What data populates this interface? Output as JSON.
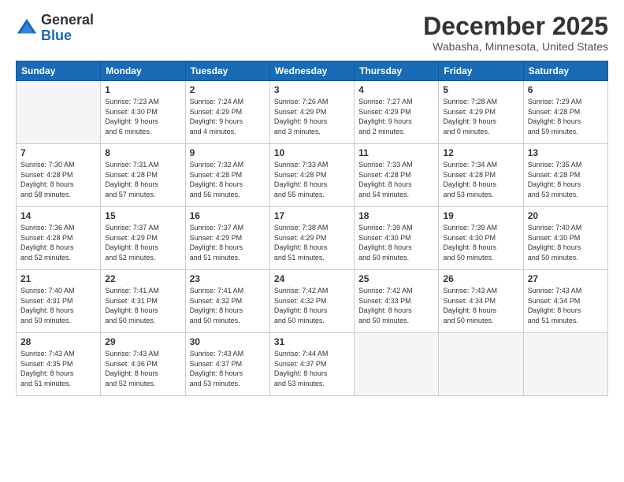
{
  "header": {
    "logo_general": "General",
    "logo_blue": "Blue",
    "month_title": "December 2025",
    "location": "Wabasha, Minnesota, United States"
  },
  "weekdays": [
    "Sunday",
    "Monday",
    "Tuesday",
    "Wednesday",
    "Thursday",
    "Friday",
    "Saturday"
  ],
  "weeks": [
    [
      {
        "day": "",
        "info": ""
      },
      {
        "day": "1",
        "info": "Sunrise: 7:23 AM\nSunset: 4:30 PM\nDaylight: 9 hours\nand 6 minutes."
      },
      {
        "day": "2",
        "info": "Sunrise: 7:24 AM\nSunset: 4:29 PM\nDaylight: 9 hours\nand 4 minutes."
      },
      {
        "day": "3",
        "info": "Sunrise: 7:26 AM\nSunset: 4:29 PM\nDaylight: 9 hours\nand 3 minutes."
      },
      {
        "day": "4",
        "info": "Sunrise: 7:27 AM\nSunset: 4:29 PM\nDaylight: 9 hours\nand 2 minutes."
      },
      {
        "day": "5",
        "info": "Sunrise: 7:28 AM\nSunset: 4:29 PM\nDaylight: 9 hours\nand 0 minutes."
      },
      {
        "day": "6",
        "info": "Sunrise: 7:29 AM\nSunset: 4:28 PM\nDaylight: 8 hours\nand 59 minutes."
      }
    ],
    [
      {
        "day": "7",
        "info": "Sunrise: 7:30 AM\nSunset: 4:28 PM\nDaylight: 8 hours\nand 58 minutes."
      },
      {
        "day": "8",
        "info": "Sunrise: 7:31 AM\nSunset: 4:28 PM\nDaylight: 8 hours\nand 57 minutes."
      },
      {
        "day": "9",
        "info": "Sunrise: 7:32 AM\nSunset: 4:28 PM\nDaylight: 8 hours\nand 56 minutes."
      },
      {
        "day": "10",
        "info": "Sunrise: 7:33 AM\nSunset: 4:28 PM\nDaylight: 8 hours\nand 55 minutes."
      },
      {
        "day": "11",
        "info": "Sunrise: 7:33 AM\nSunset: 4:28 PM\nDaylight: 8 hours\nand 54 minutes."
      },
      {
        "day": "12",
        "info": "Sunrise: 7:34 AM\nSunset: 4:28 PM\nDaylight: 8 hours\nand 53 minutes."
      },
      {
        "day": "13",
        "info": "Sunrise: 7:35 AM\nSunset: 4:28 PM\nDaylight: 8 hours\nand 53 minutes."
      }
    ],
    [
      {
        "day": "14",
        "info": "Sunrise: 7:36 AM\nSunset: 4:28 PM\nDaylight: 8 hours\nand 52 minutes."
      },
      {
        "day": "15",
        "info": "Sunrise: 7:37 AM\nSunset: 4:29 PM\nDaylight: 8 hours\nand 52 minutes."
      },
      {
        "day": "16",
        "info": "Sunrise: 7:37 AM\nSunset: 4:29 PM\nDaylight: 8 hours\nand 51 minutes."
      },
      {
        "day": "17",
        "info": "Sunrise: 7:38 AM\nSunset: 4:29 PM\nDaylight: 8 hours\nand 51 minutes."
      },
      {
        "day": "18",
        "info": "Sunrise: 7:39 AM\nSunset: 4:30 PM\nDaylight: 8 hours\nand 50 minutes."
      },
      {
        "day": "19",
        "info": "Sunrise: 7:39 AM\nSunset: 4:30 PM\nDaylight: 8 hours\nand 50 minutes."
      },
      {
        "day": "20",
        "info": "Sunrise: 7:40 AM\nSunset: 4:30 PM\nDaylight: 8 hours\nand 50 minutes."
      }
    ],
    [
      {
        "day": "21",
        "info": "Sunrise: 7:40 AM\nSunset: 4:31 PM\nDaylight: 8 hours\nand 50 minutes."
      },
      {
        "day": "22",
        "info": "Sunrise: 7:41 AM\nSunset: 4:31 PM\nDaylight: 8 hours\nand 50 minutes."
      },
      {
        "day": "23",
        "info": "Sunrise: 7:41 AM\nSunset: 4:32 PM\nDaylight: 8 hours\nand 50 minutes."
      },
      {
        "day": "24",
        "info": "Sunrise: 7:42 AM\nSunset: 4:32 PM\nDaylight: 8 hours\nand 50 minutes."
      },
      {
        "day": "25",
        "info": "Sunrise: 7:42 AM\nSunset: 4:33 PM\nDaylight: 8 hours\nand 50 minutes."
      },
      {
        "day": "26",
        "info": "Sunrise: 7:43 AM\nSunset: 4:34 PM\nDaylight: 8 hours\nand 50 minutes."
      },
      {
        "day": "27",
        "info": "Sunrise: 7:43 AM\nSunset: 4:34 PM\nDaylight: 8 hours\nand 51 minutes."
      }
    ],
    [
      {
        "day": "28",
        "info": "Sunrise: 7:43 AM\nSunset: 4:35 PM\nDaylight: 8 hours\nand 51 minutes."
      },
      {
        "day": "29",
        "info": "Sunrise: 7:43 AM\nSunset: 4:36 PM\nDaylight: 8 hours\nand 52 minutes."
      },
      {
        "day": "30",
        "info": "Sunrise: 7:43 AM\nSunset: 4:37 PM\nDaylight: 8 hours\nand 53 minutes."
      },
      {
        "day": "31",
        "info": "Sunrise: 7:44 AM\nSunset: 4:37 PM\nDaylight: 8 hours\nand 53 minutes."
      },
      {
        "day": "",
        "info": ""
      },
      {
        "day": "",
        "info": ""
      },
      {
        "day": "",
        "info": ""
      }
    ]
  ]
}
